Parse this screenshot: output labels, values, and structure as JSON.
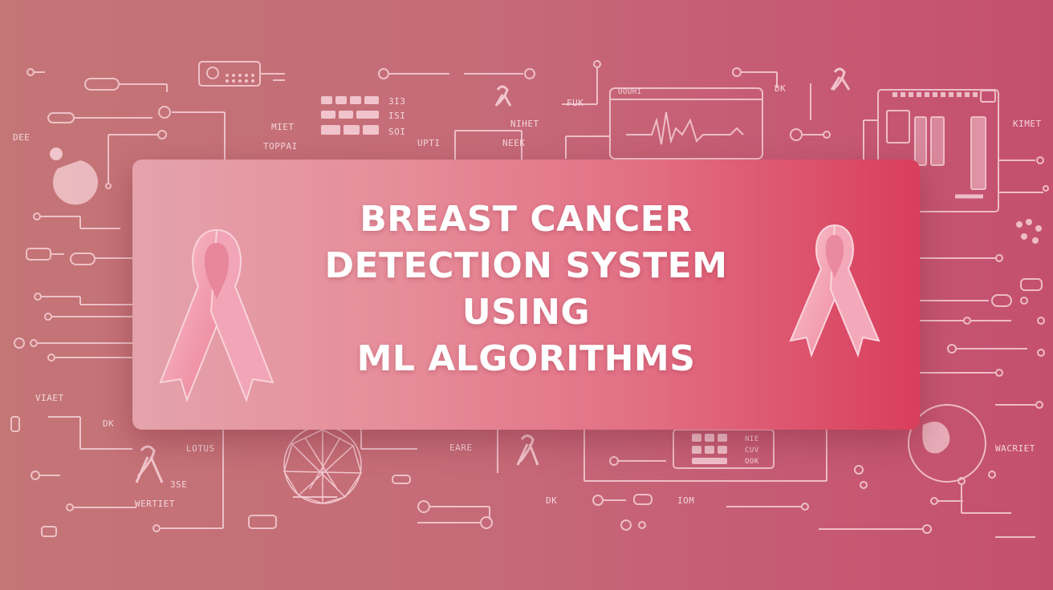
{
  "banner": {
    "title_lines": [
      "BREAST CANCER",
      "DETECTION SYSTEM",
      "USING",
      "ML ALGORITHMS"
    ]
  },
  "background_labels": [
    "DEE",
    "MIET",
    "TOPPAI",
    "3I3",
    "ISI",
    "SOI",
    "UPTI",
    "NIHET",
    "NEEK",
    "FUK",
    "UOUHI",
    "DK",
    "KIMET",
    "VIAET",
    "DK",
    "LOTUS",
    "EARE",
    "3SE",
    "WERTIET",
    "DK",
    "IOM",
    "NIE",
    "CUV",
    "OOK",
    "WACRIET"
  ],
  "colors": {
    "background_left": "#c47576",
    "background_right": "#c4506e",
    "banner_left": "#e4a3ab",
    "banner_right": "#d93e5b",
    "ribbon": "#f29fb2",
    "text": "#ffffff"
  },
  "icons": [
    "awareness-ribbon-icon",
    "heartbeat-monitor-icon",
    "globe-wireframe-icon",
    "keyboard-icon",
    "circuit-network-icon"
  ]
}
